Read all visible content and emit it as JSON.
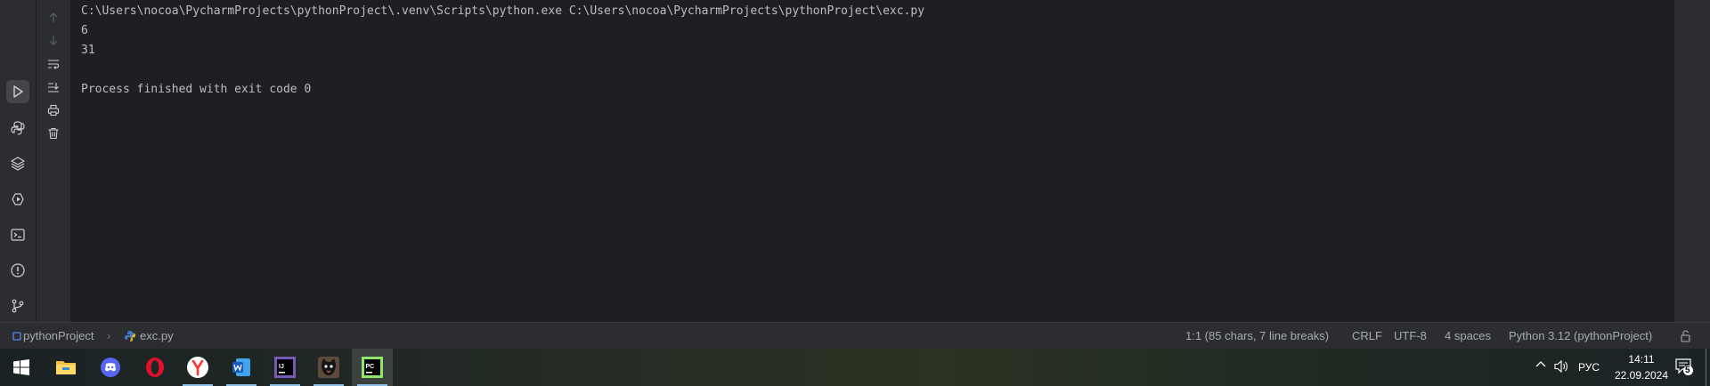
{
  "console": {
    "lines": [
      "C:\\Users\\nocoa\\PycharmProjects\\pythonProject\\.venv\\Scripts\\python.exe C:\\Users\\nocoa\\PycharmProjects\\pythonProject\\exc.py",
      "6",
      "31",
      "",
      "Process finished with exit code 0"
    ]
  },
  "left_toolbar": {
    "items": [
      {
        "icon": "run-icon",
        "active": true
      },
      {
        "icon": "python-console-icon",
        "active": false
      },
      {
        "icon": "python-packages-icon",
        "active": false
      },
      {
        "icon": "services-icon",
        "active": false
      },
      {
        "icon": "terminal-icon",
        "active": false
      },
      {
        "icon": "problems-icon",
        "active": false
      },
      {
        "icon": "git-icon",
        "active": false
      }
    ]
  },
  "run_toolbar": {
    "items": [
      "arrow-up-icon",
      "arrow-down-icon",
      "soft-wrap-icon",
      "scroll-to-end-icon",
      "print-icon",
      "trash-icon"
    ]
  },
  "statusbar": {
    "project": "pythonProject",
    "file": "exc.py",
    "position": "1:1 (85 chars, 7 line breaks)",
    "line_separator": "CRLF",
    "encoding": "UTF-8",
    "indent": "4 spaces",
    "interpreter": "Python 3.12 (pythonProject)"
  },
  "taskbar": {
    "apps": [
      "windows-start-icon",
      "file-explorer-icon",
      "discord-icon",
      "opera-icon",
      "yandex-browser-icon",
      "word-icon",
      "intellij-idea-icon",
      "cat-app-icon",
      "pycharm-icon"
    ],
    "language": "РУС",
    "time": "14:11",
    "date": "22.09.2024",
    "notifications": "5"
  },
  "colors": {
    "accent": "#3574f0",
    "console_text": "#bcbec4",
    "panel": "#2b2d30",
    "background": "#1e1f22"
  }
}
